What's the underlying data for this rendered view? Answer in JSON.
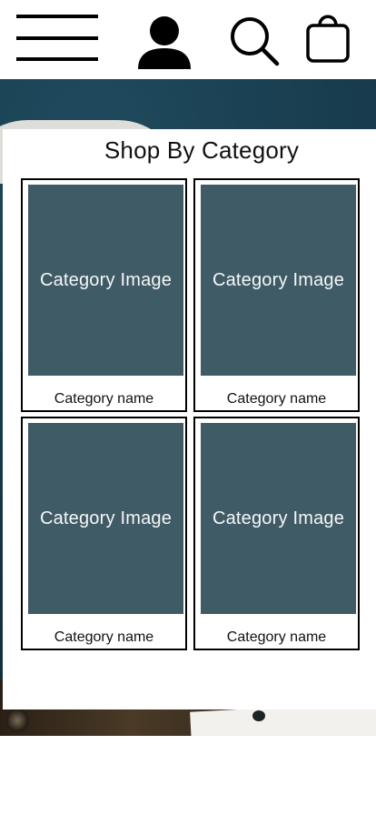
{
  "header": {
    "icons": [
      "hamburger-menu-icon",
      "account-icon",
      "search-icon",
      "shopping-bag-icon"
    ]
  },
  "category_section": {
    "title": "Shop By Category",
    "cards": [
      {
        "image_label": "Category Image",
        "name": "Category name"
      },
      {
        "image_label": "Category Image",
        "name": "Category name"
      },
      {
        "image_label": "Category Image",
        "name": "Category name"
      },
      {
        "image_label": "Category Image",
        "name": "Category name"
      }
    ]
  },
  "colors": {
    "placeholder_fill": "#3f5b65",
    "hero_background": "#153746",
    "border": "#000000"
  }
}
